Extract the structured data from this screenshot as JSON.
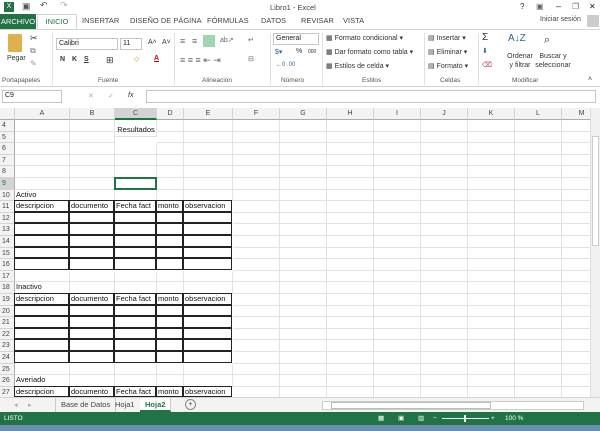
{
  "window": {
    "title": "Libro1 - Excel",
    "help": "?",
    "restore_ribbon": "▣",
    "minimize": "–",
    "maximize": "❐",
    "close": "✕"
  },
  "tabs": {
    "file": "ARCHIVO",
    "items": [
      "INICIO",
      "INSERTAR",
      "DISEÑO DE PÁGINA",
      "FÓRMULAS",
      "DATOS",
      "REVISAR",
      "VISTA"
    ],
    "signin": "Iniciar sesión"
  },
  "ribbon": {
    "clipboard": {
      "paste": "Pegar",
      "group": "Portapapeles"
    },
    "font": {
      "name": "Calibri",
      "size": "11",
      "bold": "N",
      "italic": "K",
      "underline": "S",
      "group": "Fuente"
    },
    "alignment": {
      "group": "Alineación"
    },
    "number": {
      "format": "General",
      "percent": "%",
      "thousands": "000",
      "group": "Número"
    },
    "styles": {
      "conditional": "Formato condicional",
      "table": "Dar formato como tabla",
      "cell_styles": "Estilos de celda",
      "group": "Estilos"
    },
    "cells": {
      "insert": "Insertar",
      "delete": "Eliminar",
      "format": "Formato",
      "group": "Celdas"
    },
    "editing": {
      "sum": "Σ",
      "sort": "Ordenar y filtrar",
      "find": "Buscar y seleccionar",
      "group": "Modificar"
    }
  },
  "formula_bar": {
    "name_box": "C9",
    "fx": "fx",
    "cancel": "✕",
    "enter": "✓",
    "value": ""
  },
  "grid": {
    "columns": [
      "A",
      "B",
      "C",
      "D",
      "E",
      "F",
      "G",
      "H",
      "I",
      "J",
      "K",
      "L",
      "M"
    ],
    "first_row": 4,
    "last_row": 27,
    "selected": "C9",
    "cells": [
      {
        "ref": "C5",
        "text": "Resultados"
      },
      {
        "ref": "A10",
        "text": "Activo"
      },
      {
        "ref": "A11",
        "text": "descripcion"
      },
      {
        "ref": "B11",
        "text": "documento"
      },
      {
        "ref": "C11",
        "text": "Fecha fact"
      },
      {
        "ref": "D11",
        "text": "monto"
      },
      {
        "ref": "E11",
        "text": "observacion"
      },
      {
        "ref": "A18",
        "text": "Inactivo"
      },
      {
        "ref": "A19",
        "text": "descripcion"
      },
      {
        "ref": "B19",
        "text": "documento"
      },
      {
        "ref": "C19",
        "text": "Fecha fact"
      },
      {
        "ref": "D19",
        "text": "monto"
      },
      {
        "ref": "E19",
        "text": "observacion"
      },
      {
        "ref": "A26",
        "text": "Averiado"
      },
      {
        "ref": "A27",
        "text": "descripcion"
      },
      {
        "ref": "B27",
        "text": "documento"
      },
      {
        "ref": "C27",
        "text": "Fecha fact"
      },
      {
        "ref": "D27",
        "text": "monto"
      },
      {
        "ref": "E27",
        "text": "observacion"
      }
    ]
  },
  "sheets": {
    "items": [
      "Base de Datos",
      "Hoja1",
      "Hoja2"
    ],
    "active": "Hoja2",
    "add": "+"
  },
  "status": {
    "ready": "LISTO",
    "zoom": "100 %",
    "zoom_level": 100
  },
  "colors": {
    "accent": "#217346"
  }
}
